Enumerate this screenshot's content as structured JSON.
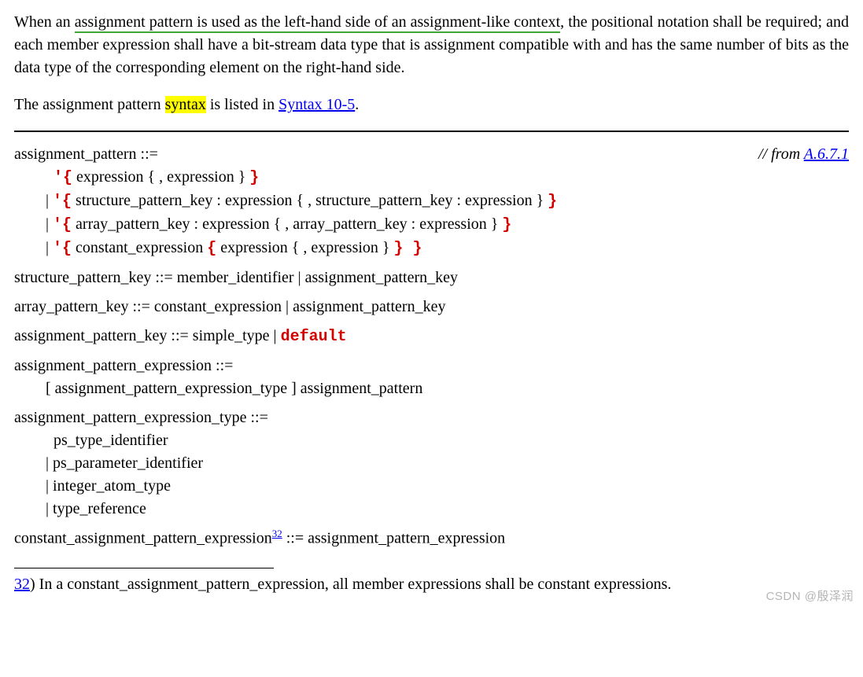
{
  "intro": {
    "p1_a": "When an ",
    "p1_underlined": "assignment pattern is used as the left-hand side of an assignment-like context",
    "p1_b": ", the positional notation shall be required; and each member expression shall have a bit-stream data type that is assignment compatible with and has the same number of bits as the data type of the corresponding element on the right-hand side.",
    "p2_a": "The assignment pattern ",
    "p2_hl": "syntax",
    "p2_b": " is listed in ",
    "p2_link": "Syntax 10-5",
    "p2_c": "."
  },
  "from_ref": {
    "prefix": "// from ",
    "link": "A.6.7.1"
  },
  "syntax": {
    "assignment_pattern": {
      "head": "assignment_pattern ::=",
      "alt1_a": "'{",
      "alt1_b": " expression { , expression } ",
      "alt1_c": "}",
      "alt2_a": "'{",
      "alt2_b": " structure_pattern_key : expression { , structure_pattern_key : expression } ",
      "alt2_c": "}",
      "alt3_a": "'{",
      "alt3_b": " array_pattern_key : expression { , array_pattern_key : expression } ",
      "alt3_c": "}",
      "alt4_a": "'{",
      "alt4_b": " constant_expression ",
      "alt4_c": "{",
      "alt4_d": " expression { , expression } ",
      "alt4_e": "} }"
    },
    "structure_pattern_key": "structure_pattern_key ::= member_identifier | assignment_pattern_key",
    "array_pattern_key": "array_pattern_key ::= constant_expression | assignment_pattern_key",
    "assignment_pattern_key": {
      "a": "assignment_pattern_key ::= simple_type | ",
      "kw": "default"
    },
    "assignment_pattern_expression": {
      "head": "assignment_pattern_expression ::=",
      "body": "[ assignment_pattern_expression_type ] assignment_pattern"
    },
    "assignment_pattern_expression_type": {
      "head": "assignment_pattern_expression_type ::=",
      "alt1": "ps_type_identifier",
      "alt2": "ps_parameter_identifier",
      "alt3": "integer_atom_type",
      "alt4": "type_reference"
    },
    "constant_ape": {
      "a": "constant_assignment_pattern_expression",
      "sup": "32",
      "b": " ::= assignment_pattern_expression"
    }
  },
  "footnote": {
    "num": "32",
    "sep": ")   ",
    "text": "In a constant_assignment_pattern_expression, all member expressions shall be constant expressions."
  },
  "watermark": "CSDN @殷泽润"
}
